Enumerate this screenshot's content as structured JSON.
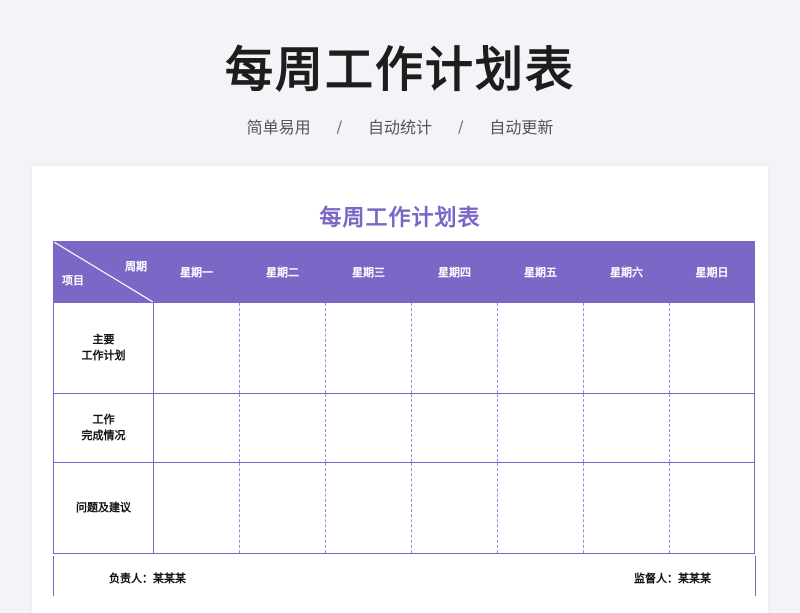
{
  "hero": {
    "title": "每周工作计划表",
    "tags": [
      "简单易用",
      "自动统计",
      "自动更新"
    ],
    "separator": "/"
  },
  "sheet": {
    "title": "每周工作计划表",
    "corner_top": "周期",
    "corner_bottom": "项目",
    "days": [
      "星期一",
      "星期二",
      "星期三",
      "星期四",
      "星期五",
      "星期六",
      "星期日"
    ],
    "rows": [
      {
        "line1": "主要",
        "line2": "工作计划"
      },
      {
        "line1": "工作",
        "line2": "完成情况"
      },
      {
        "line1": "问题及建议",
        "line2": ""
      }
    ],
    "footer": {
      "responsible": "负责人：某某某",
      "supervisor": "监督人：某某某"
    }
  },
  "colors": {
    "accent": "#7b68c6",
    "title": "#7a66c4",
    "background": "#f3f4f7"
  }
}
